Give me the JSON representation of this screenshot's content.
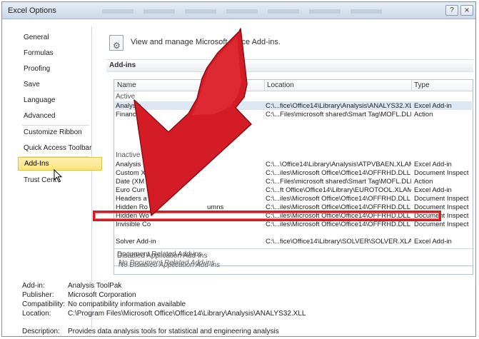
{
  "window": {
    "title": "Excel Options",
    "help_label": "?",
    "close_label": "×"
  },
  "sidebar": {
    "items": [
      {
        "label": "General"
      },
      {
        "label": "Formulas"
      },
      {
        "label": "Proofing"
      },
      {
        "label": "Save"
      },
      {
        "label": "Language"
      },
      {
        "label": "Advanced"
      },
      {
        "label": "Customize Ribbon"
      },
      {
        "label": "Quick Access Toolbar"
      },
      {
        "label": "Add-Ins"
      },
      {
        "label": "Trust Cent"
      }
    ],
    "active": "Add-Ins"
  },
  "main": {
    "header": "View and manage Microsoft Office Add-ins.",
    "section": "Add-ins",
    "columns": {
      "name": "Name",
      "location": "Location",
      "type": "Type"
    },
    "groups": {
      "active": "Active",
      "inactive": "Inactive"
    },
    "active_rows": [
      {
        "name": "Analysis",
        "location": "C:\\...fice\\Office14\\Library\\Analysis\\ANALYS32.XLL",
        "type": "Excel Add-in"
      },
      {
        "name": "Financ",
        "location": "C:\\...Files\\microsoft shared\\Smart Tag\\MOFL.DLL",
        "type": "Action"
      }
    ],
    "inactive_rows": [
      {
        "name": "Analysis",
        "location": "C:\\...\\Office14\\Library\\Analysis\\ATPVBAEN.XLAM",
        "type": "Excel Add-in"
      },
      {
        "name": "Custom X",
        "location": "C:\\...iles\\Microsoft Office\\Office14\\OFFRHD.DLL",
        "type": "Document Inspect"
      },
      {
        "name": "Date (XM",
        "location": "C:\\...Files\\microsoft shared\\Smart Tag\\MOFL.DLL",
        "type": "Action"
      },
      {
        "name": "Euro Curr",
        "location": "C:\\...ft Office\\Office14\\Library\\EUROTOOL.XLAM",
        "type": "Excel Add-in"
      },
      {
        "name": "Headers a",
        "location": "C:\\...iles\\Microsoft Office\\Office14\\OFFRHD.DLL",
        "type": "Document Inspect"
      },
      {
        "name": "Hidden Ro",
        "name_tail": "umns",
        "location": "C:\\...iles\\Microsoft Office\\Office14\\OFFRHD.DLL",
        "type": "Document Inspect"
      },
      {
        "name": "Hidden Wo",
        "location": "C:\\...iles\\Microsoft Office\\Office14\\OFFRHD.DLL",
        "type": "Document Inspect"
      },
      {
        "name": "Invisible Co",
        "location": "C:\\...iles\\Microsoft Office\\Office14\\OFFRHD.DLL",
        "type": "Document Inspect"
      }
    ],
    "solver_row": {
      "name": "Solver Add-in",
      "location": "C:\\...fice\\Office14\\Library\\SOLVER\\SOLVER.XLAM",
      "type": "Excel Add-in"
    },
    "doc_group": "Document Related Add-ins",
    "doc_empty": "No Document Related Add-ins",
    "disabled_group": "Disabled Application Add-ins",
    "disabled_empty": "No Disabled Application Add-ins",
    "details": {
      "addin_label": "Add-in:",
      "addin_value": "Analysis ToolPak",
      "publisher_label": "Publisher:",
      "publisher_value": "Microsoft Corporation",
      "compat_label": "Compatibility:",
      "compat_value": "No compatibility information available",
      "location_label": "Location:",
      "location_value": "C:\\Program Files\\Microsoft Office\\Office14\\Library\\Analysis\\ANALYS32.XLL",
      "desc_label": "Description:",
      "desc_value": "Provides data analysis tools for statistical and engineering analysis"
    }
  },
  "colors": {
    "arrow": "#d31c26",
    "highlight": "#d31c26",
    "active_nav": "#fde37c"
  }
}
